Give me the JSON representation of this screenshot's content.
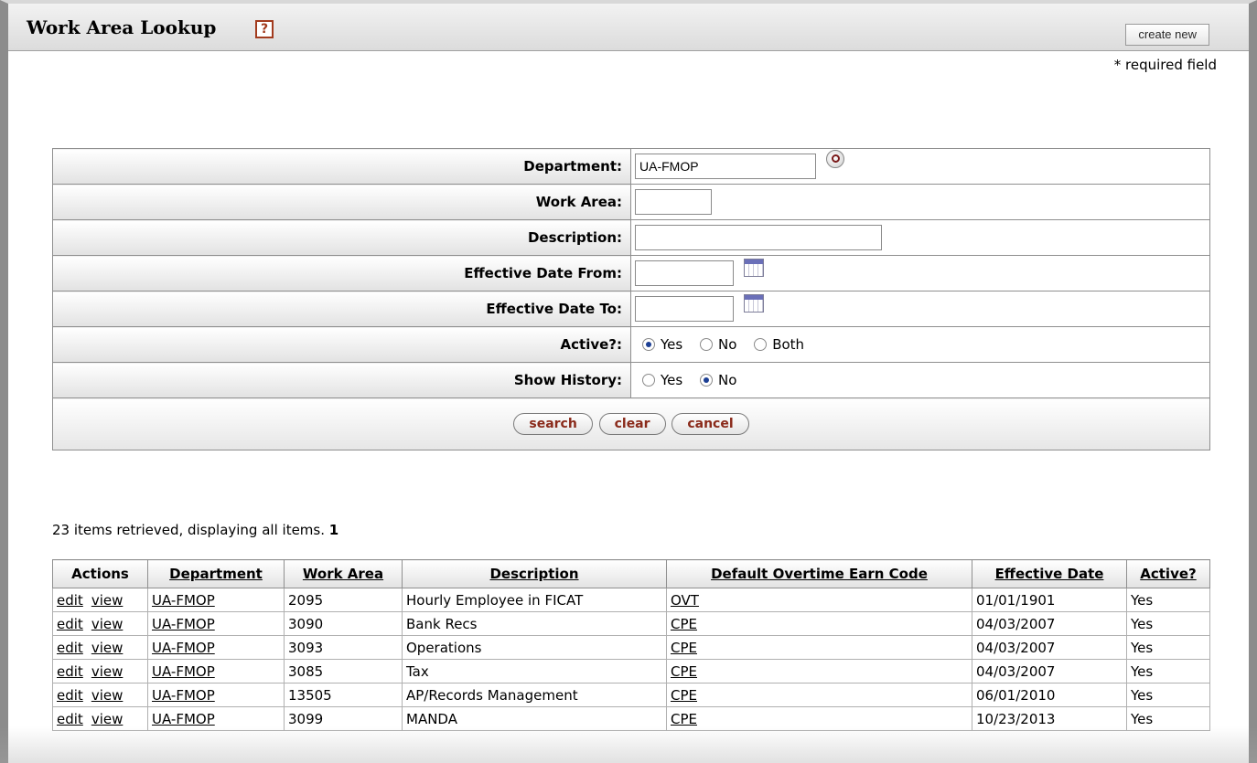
{
  "header": {
    "title": "Work Area Lookup",
    "help_icon": "?",
    "create_new_label": "create new",
    "required_note": "* required field"
  },
  "criteria": {
    "department_label": "Department:",
    "department_value": "UA-FMOP",
    "work_area_label": "Work Area:",
    "work_area_value": "",
    "description_label": "Description:",
    "description_value": "",
    "eff_from_label": "Effective Date From:",
    "eff_from_value": "",
    "eff_to_label": "Effective Date To:",
    "eff_to_value": "",
    "active_label": "Active?:",
    "active_options": [
      "Yes",
      "No",
      "Both"
    ],
    "active_selected": "Yes",
    "history_label": "Show History:",
    "history_options": [
      "Yes",
      "No"
    ],
    "history_selected": "No",
    "buttons": {
      "search": "search",
      "clear": "clear",
      "cancel": "cancel"
    }
  },
  "results": {
    "count_text": "23 items retrieved, displaying all items.",
    "page": "1",
    "columns": [
      "Actions",
      "Department",
      "Work Area",
      "Description",
      "Default Overtime Earn Code",
      "Effective Date",
      "Active?"
    ],
    "action_labels": {
      "edit": "edit",
      "view": "view"
    },
    "rows": [
      {
        "department": "UA-FMOP",
        "work_area": "2095",
        "description": "Hourly Employee in FICAT",
        "earn_code": "OVT",
        "effective_date": "01/01/1901",
        "active": "Yes"
      },
      {
        "department": "UA-FMOP",
        "work_area": "3090",
        "description": "Bank Recs",
        "earn_code": "CPE",
        "effective_date": "04/03/2007",
        "active": "Yes"
      },
      {
        "department": "UA-FMOP",
        "work_area": "3093",
        "description": "Operations",
        "earn_code": "CPE",
        "effective_date": "04/03/2007",
        "active": "Yes"
      },
      {
        "department": "UA-FMOP",
        "work_area": "3085",
        "description": "Tax",
        "earn_code": "CPE",
        "effective_date": "04/03/2007",
        "active": "Yes"
      },
      {
        "department": "UA-FMOP",
        "work_area": "13505",
        "description": "AP/Records Management",
        "earn_code": "CPE",
        "effective_date": "06/01/2010",
        "active": "Yes"
      },
      {
        "department": "UA-FMOP",
        "work_area": "3099",
        "description": "MANDA",
        "earn_code": "CPE",
        "effective_date": "10/23/2013",
        "active": "Yes"
      }
    ]
  }
}
